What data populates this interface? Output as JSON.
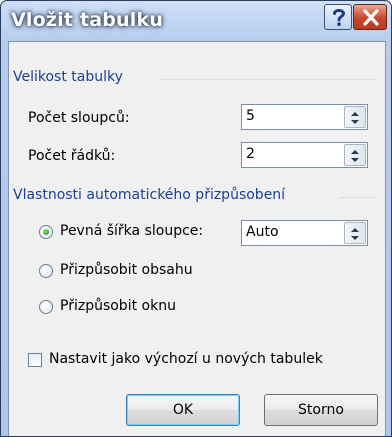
{
  "window": {
    "title": "Vložit tabulku"
  },
  "titlebar": {
    "help_icon": "question-mark",
    "close_icon": "x-mark"
  },
  "table_size": {
    "group_label": "Velikost tabulky",
    "columns_label": "Počet sloupců:",
    "columns_value": "5",
    "rows_label": "Počet řádků:",
    "rows_value": "2"
  },
  "autofit": {
    "group_label": "Vlastnosti automatického přizpůsobení",
    "fixed_width_label": "Pevná šířka sloupce:",
    "fixed_width_value": "Auto",
    "fit_contents_label": "Přizpůsobit obsahu",
    "fit_window_label": "Přizpůsobit oknu",
    "selected": "fixed_width"
  },
  "default_checkbox": {
    "label": "Nastavit jako výchozí u nových tabulek",
    "checked": false
  },
  "buttons": {
    "ok": "OK",
    "cancel": "Storno"
  }
}
